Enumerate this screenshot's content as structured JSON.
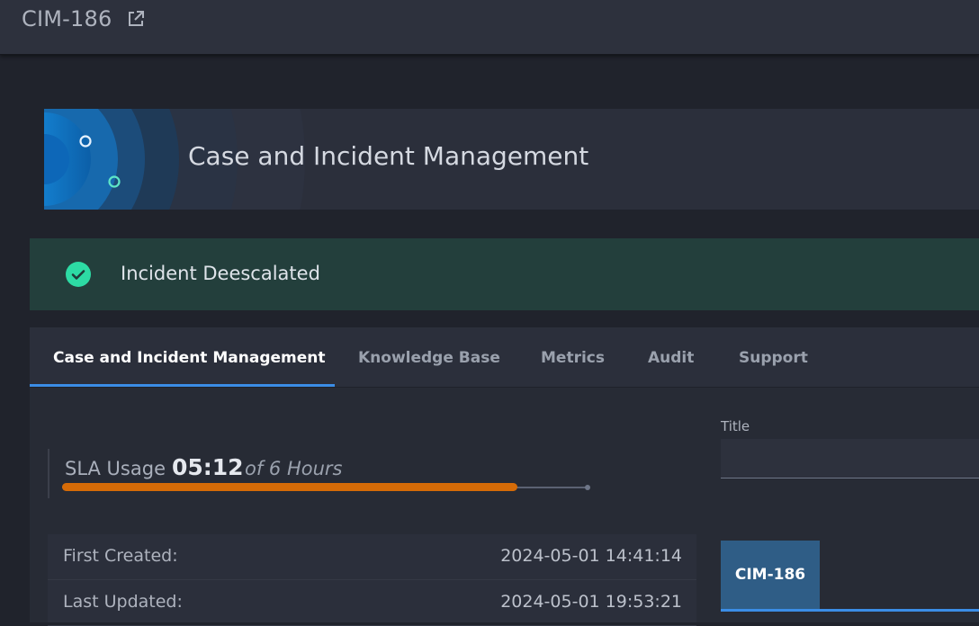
{
  "header": {
    "ticket_id": "CIM-186",
    "external_link_icon": "external-link-icon"
  },
  "banner": {
    "title": "Case and Incident Management"
  },
  "alert": {
    "message": "Incident Deescalated",
    "icon": "check-circle-icon",
    "color": "#2ddba4"
  },
  "tabs": [
    {
      "label": "Case and Incident Management",
      "active": true
    },
    {
      "label": "Knowledge Base",
      "active": false
    },
    {
      "label": "Metrics",
      "active": false
    },
    {
      "label": "Audit",
      "active": false
    },
    {
      "label": "Support",
      "active": false
    }
  ],
  "sla": {
    "label": "SLA Usage",
    "value": "05:12",
    "of": "of 6 Hours",
    "fraction": 0.867,
    "bar_color": "#d56b07"
  },
  "info": {
    "first_created_label": "First Created:",
    "first_created_value": "2024-05-01 14:41:14",
    "last_updated_label": "Last Updated:",
    "last_updated_value": "2024-05-01 19:53:21"
  },
  "form": {
    "title_label": "Title",
    "title_value": ""
  },
  "record_chip": {
    "label": "CIM-186"
  },
  "colors": {
    "accent": "#3b8de6",
    "chip": "#2f5d86",
    "alert_bg": "#233f3c"
  }
}
